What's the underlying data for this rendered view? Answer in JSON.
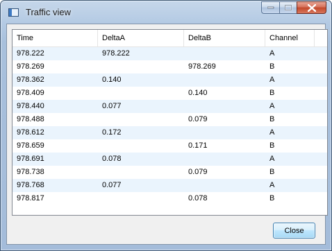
{
  "window": {
    "title": "Traffic view"
  },
  "list": {
    "columns": [
      "Time",
      "DeltaA",
      "DeltaB",
      "Channel"
    ],
    "rows": [
      {
        "time": "978.222",
        "delta_a": "978.222",
        "delta_b": "",
        "channel": "A"
      },
      {
        "time": "978.269",
        "delta_a": "",
        "delta_b": "978.269",
        "channel": "B"
      },
      {
        "time": "978.362",
        "delta_a": "0.140",
        "delta_b": "",
        "channel": "A"
      },
      {
        "time": "978.409",
        "delta_a": "",
        "delta_b": "0.140",
        "channel": "B"
      },
      {
        "time": "978.440",
        "delta_a": "0.077",
        "delta_b": "",
        "channel": "A"
      },
      {
        "time": "978.488",
        "delta_a": "",
        "delta_b": "0.079",
        "channel": "B"
      },
      {
        "time": "978.612",
        "delta_a": "0.172",
        "delta_b": "",
        "channel": "A"
      },
      {
        "time": "978.659",
        "delta_a": "",
        "delta_b": "0.171",
        "channel": "B"
      },
      {
        "time": "978.691",
        "delta_a": "0.078",
        "delta_b": "",
        "channel": "A"
      },
      {
        "time": "978.738",
        "delta_a": "",
        "delta_b": "0.079",
        "channel": "B"
      },
      {
        "time": "978.768",
        "delta_a": "0.077",
        "delta_b": "",
        "channel": "A"
      },
      {
        "time": "978.817",
        "delta_a": "",
        "delta_b": "0.078",
        "channel": "B"
      }
    ]
  },
  "buttons": {
    "close_label": "Close"
  },
  "icons": {
    "app": "window-icon",
    "minimize": "minimize-icon",
    "maximize": "maximize-icon",
    "close": "close-icon"
  },
  "colors": {
    "row_highlight": "#eaf4fd",
    "close_caption": "#c3482a"
  }
}
